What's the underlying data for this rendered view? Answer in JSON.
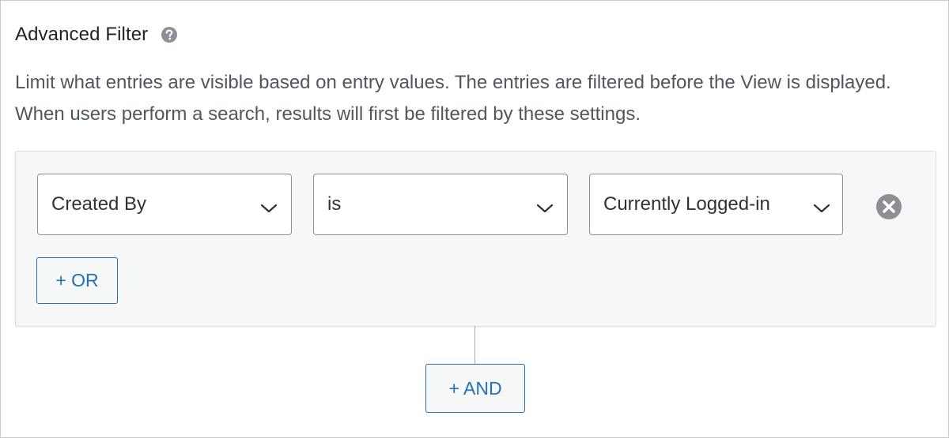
{
  "panel": {
    "title": "Advanced Filter",
    "help_icon": "question-circle-icon",
    "description": "Limit what entries are visible based on entry values. The entries are filtered before the View is displayed. When users perform a search, results will first be filtered by these settings."
  },
  "filter": {
    "condition": {
      "field": "Created By",
      "operator": "is",
      "value": "Currently Logged-in",
      "remove_icon": "close-circle-icon"
    },
    "or_button_label": "+ OR",
    "and_button_label": "+ AND"
  },
  "colors": {
    "accent": "#2271b1",
    "panel_bg": "#f6f7f7",
    "text": "#1d2327",
    "muted_text": "#50575e"
  }
}
